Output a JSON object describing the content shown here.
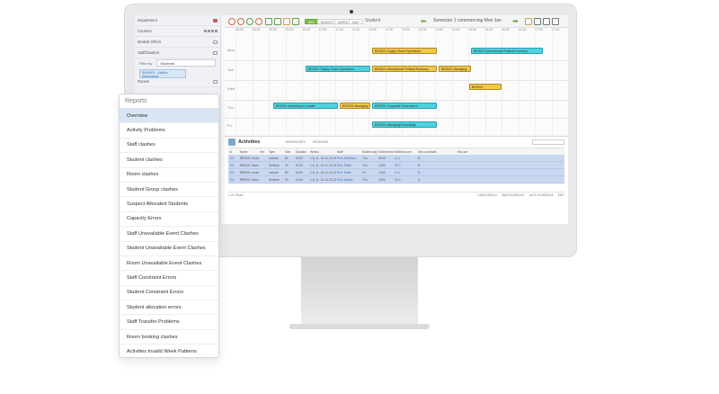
{
  "sidebar": {
    "items": [
      {
        "label": "Department"
      },
      {
        "label": "Courses"
      },
      {
        "label": "Module Offers"
      },
      {
        "label": "Staff/Student"
      }
    ],
    "filter_label": "Filter by",
    "filter_value": "Students",
    "selected_tag": "S000001 - Abidhu Abamnahat",
    "rooms_label": "Rooms"
  },
  "toolbar": {
    "views": [
      "ALL",
      "MONTH",
      "WEEK",
      "DAY"
    ],
    "active_view": "ALL",
    "entity": "Student",
    "semester": "Semester 1 commencing Mon Jan"
  },
  "timetable": {
    "hours": [
      "08:00",
      "08:30",
      "09:00",
      "09:30",
      "10:00",
      "10:30",
      "11:00",
      "11:30",
      "12:00",
      "12:30",
      "13:00",
      "13:30",
      "14:00",
      "14:30",
      "15:00",
      "15:30",
      "16:00",
      "16:30",
      "17:00",
      "17:30"
    ],
    "days": [
      "Mon",
      "Tue",
      "Wed",
      "Thu",
      "Fri"
    ],
    "events": [
      {
        "label": "BRS02L Supply Chain Operations",
        "kind": "y"
      },
      {
        "label": "BRS02L International Political Economy",
        "kind": "c"
      },
      {
        "label": "BRS02L Supply Chain Operations",
        "kind": "c"
      },
      {
        "label": "BRS02L International Political Economy",
        "kind": "y"
      },
      {
        "label": "BRS02L Managing",
        "kind": "y"
      },
      {
        "label": "BRS02L",
        "kind": "y"
      },
      {
        "label": "BRS02L Marketing to Leader",
        "kind": "c"
      },
      {
        "label": "BRS02L Managing",
        "kind": "y"
      },
      {
        "label": "BRS02L Corporate Governance",
        "kind": "c"
      },
      {
        "label": "BRS02L Managing Knowledge",
        "kind": "c"
      }
    ]
  },
  "activities": {
    "title": "Activities",
    "tabs": [
      "WORKSHOPS",
      "SESSIONS"
    ],
    "columns": [
      "Id",
      "Name",
      "Ver",
      "Type",
      "Size",
      "Duration",
      "Weeks",
      "Staff",
      "Earliest day",
      "Earliest time",
      "Earliest room",
      "Has constraint",
      "Has set"
    ],
    "rows": [
      [
        "741",
        "BRS02L Lecture",
        "",
        "Lecture",
        "80",
        "02:00",
        "1-6, 11, 12-14, 20-24",
        "Prof. Anderson",
        "Thu",
        "09:00",
        "L1.1",
        "N",
        ""
      ],
      [
        "742",
        "BRS02L Seminar A",
        "",
        "Seminar",
        "30",
        "01:00",
        "1-6, 11, 12-14, 20-24",
        "Prof. Smith",
        "Thu",
        "12:00",
        "S2.3",
        "N",
        ""
      ],
      [
        "743",
        "BRS02L Lecture",
        "",
        "Lecture",
        "80",
        "02:00",
        "1-6, 11, 12-14, 20-24",
        "Prof. Smith",
        "Fri",
        "10:00",
        "L1.2",
        "N",
        ""
      ],
      [
        "744",
        "BRS02L Seminar B",
        "",
        "Seminar",
        "30",
        "01:00",
        "1-6, 11, 12-14, 20-24",
        "Prof. Adams",
        "Thu",
        "15:00",
        "S2.4",
        "N",
        ""
      ]
    ],
    "footer_left": "1 of 4 Rows",
    "footer_buttons": [
      "UNSCHEDULE",
      "MAN SCHEDULE",
      "AUTO SCHEDULE",
      "EDIT"
    ]
  },
  "reports": {
    "title": "Reports",
    "selected_index": 0,
    "items": [
      "Overview",
      "Activity Problems",
      "Staff clashes",
      "Student clashes",
      "Room clashes",
      "Student Group clashes",
      "Suspect Allocated Students",
      "Capacity Errors",
      "Staff Unavailable Event Clashes",
      "Student Unavailable Event Clashes",
      "Room Unavailable Event Clashes",
      "Staff Constraint Errors",
      "Student Constraint Errors",
      "Student allocation errors",
      "Staff Transfer Problems",
      "Room booking clashes",
      "Activities Invalid Week Patterns"
    ]
  },
  "colors": {
    "accent_green": "#7fbd4a",
    "event_yellow": "#f2c845",
    "event_cyan": "#4fd2e0",
    "row_highlight": "#c9d7f0",
    "selected_report": "#d9e5f3"
  }
}
